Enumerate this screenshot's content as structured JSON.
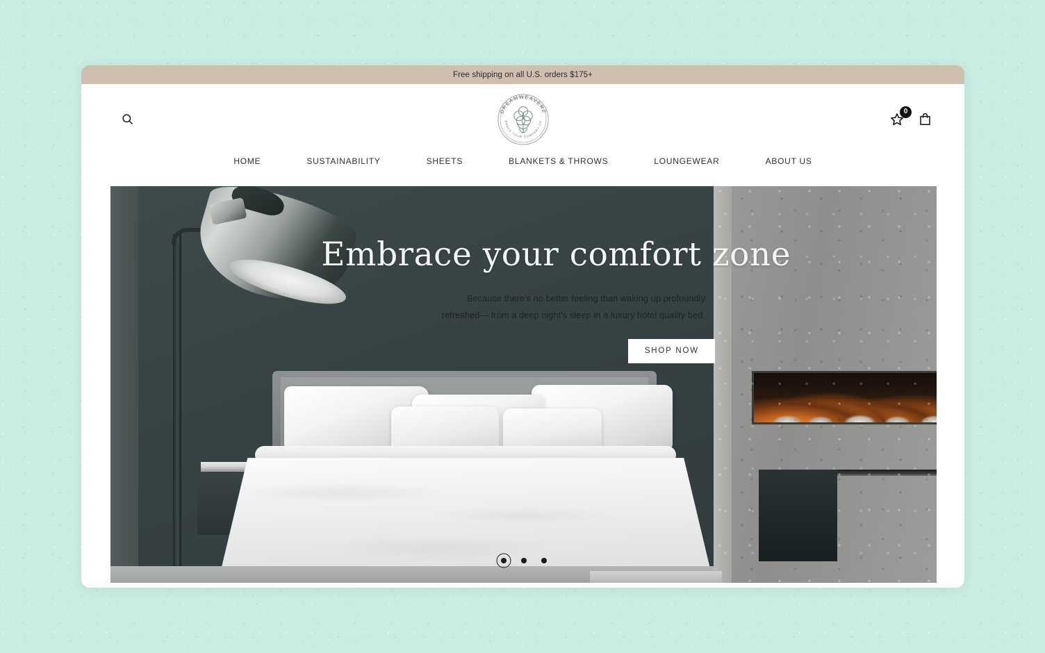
{
  "background": {
    "color": "#c9ece3"
  },
  "announcement": {
    "text": "Free shipping on all U.S. orders $175+",
    "bg_color": "#cfbfae"
  },
  "header": {
    "search_icon": "search-icon",
    "logo": {
      "top_arc_text": "DREAMWEAVERZ",
      "bottom_arc_text": "EMBRACE YOUR COMFORT ZONE",
      "center_motif": "cotton-boll"
    },
    "actions": [
      {
        "icon": "wishlist-star-icon",
        "badge_count": "0"
      },
      {
        "icon": "shopping-bag-icon"
      }
    ]
  },
  "nav": {
    "items": [
      {
        "label": "HOME"
      },
      {
        "label": "SUSTAINABILITY"
      },
      {
        "label": "SHEETS"
      },
      {
        "label": "BLANKETS & THROWS"
      },
      {
        "label": "LOUNGEWEAR"
      },
      {
        "label": "ABOUT US"
      }
    ]
  },
  "hero": {
    "title": "Embrace your comfort zone",
    "subtitle_line1": "Because there's no better feeling than waking up profoundly refreshed—",
    "subtitle_line2": "from a deep night's sleep in a luxury hotel quality bed.",
    "cta_label": "SHOP NOW",
    "image_alt": "Bedroom with white bed, floor lamp and fireplace",
    "carousel": {
      "total_slides": "3",
      "active_slide": "1"
    }
  }
}
